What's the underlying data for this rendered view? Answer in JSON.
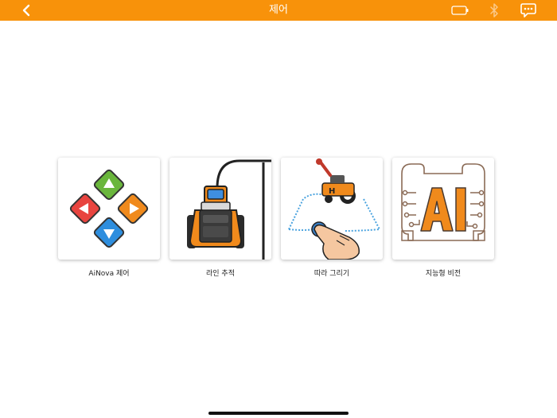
{
  "header": {
    "title": "제어",
    "background_color": "#f8920a",
    "back_icon": "chevron-left-icon",
    "battery_icon": "battery-icon",
    "bluetooth_icon": "bluetooth-icon",
    "chat_icon": "chat-bubble-icon"
  },
  "menu": {
    "items": [
      {
        "label": "AiNova 제어",
        "icon": "direction-pad-icon"
      },
      {
        "label": "라인 추적",
        "icon": "line-tracking-robot-icon"
      },
      {
        "label": "따라 그리기",
        "icon": "draw-path-icon"
      },
      {
        "label": "지능형 비전",
        "icon": "ai-chip-icon"
      }
    ]
  }
}
